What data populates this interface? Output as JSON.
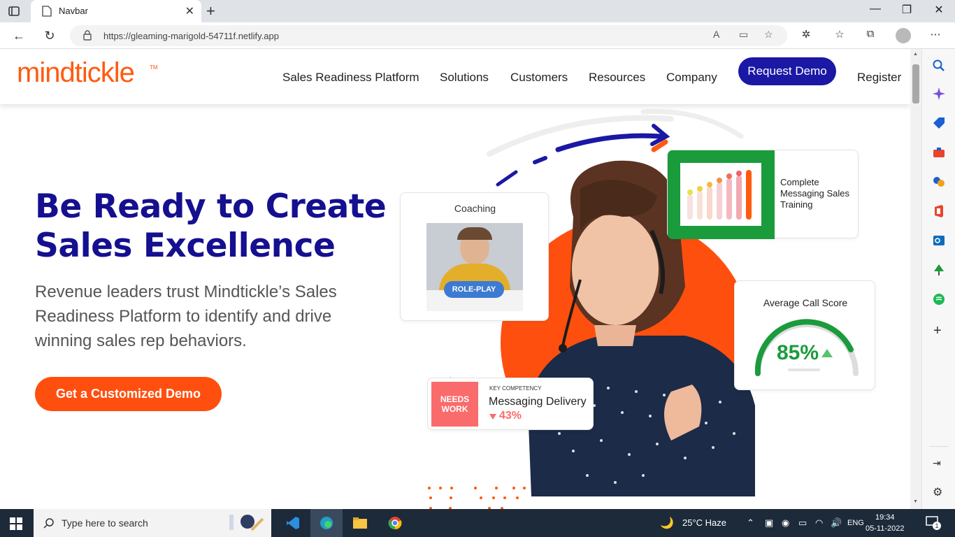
{
  "browser": {
    "tab_title": "Navbar",
    "url": "https://gleaming-marigold-54711f.netlify.app"
  },
  "navbar": {
    "logo_text": "mindtickle",
    "logo_tm": "TM",
    "links": [
      "Sales Readiness Platform",
      "Solutions",
      "Customers",
      "Resources",
      "Company"
    ],
    "request_demo": "Request Demo",
    "register": "Register"
  },
  "hero": {
    "title": "Be Ready to Create Sales Excellence",
    "subtitle": "Revenue leaders trust Mindtickle’s Sales Readiness Platform to identify and drive winning sales rep behaviors.",
    "cta": "Get a Customized Demo"
  },
  "cards": {
    "coaching_title": "Coaching",
    "role_play_badge": "ROLE-PLAY",
    "training_title": "Complete Messaging Sales Training",
    "call_score_title": "Average Call Score",
    "call_score_value": "85%",
    "needs_work": "NEEDS WORK",
    "key_competency": "KEY COMPETENCY",
    "competency_name": "Messaging Delivery",
    "competency_change": "43%"
  },
  "taskbar": {
    "search_placeholder": "Type here to search",
    "weather": "25°C  Haze",
    "lang": "ENG",
    "time": "19:34",
    "date": "05-11-2022",
    "notif_count": "1"
  },
  "colors": {
    "brand_orange": "#ff5a0f",
    "brand_navy": "#1a18a5",
    "green": "#18a03a"
  }
}
